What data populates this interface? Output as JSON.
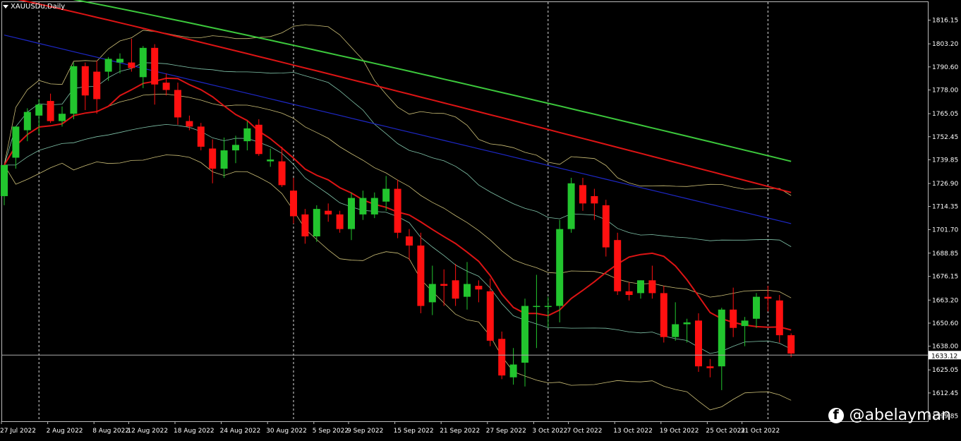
{
  "symbol": "XAUUSDu,Daily",
  "watermark": {
    "icon": "facebook-icon",
    "handle": "@abelayman"
  },
  "current_price": "1633.12",
  "colors": {
    "background": "#000000",
    "bull": "#22c52e",
    "bear": "#ff1010",
    "ma_green": "#3cc83c",
    "ma_red": "#dc1414",
    "ma_blue": "#1e28c8",
    "bb_outer": "#f0e08c",
    "bb_inner": "#96e6c8",
    "price_line": "#aaaaaa"
  },
  "chart_data": {
    "type": "candlestick",
    "ylim": [
      1597,
      1826
    ],
    "y_ticks": [
      "1816.15",
      "1803.20",
      "1790.60",
      "1778.00",
      "1765.05",
      "1752.45",
      "1739.85",
      "1726.90",
      "1714.35",
      "1701.70",
      "1688.85",
      "1676.15",
      "1663.20",
      "1650.60",
      "1638.00",
      "1625.05",
      "1612.45",
      "1599.85"
    ],
    "x_labels": [
      "27 Jul 2022",
      "2 Aug 2022",
      "8 Aug 2022",
      "12 Aug 2022",
      "18 Aug 2022",
      "24 Aug 2022",
      "30 Aug 2022",
      "5 Sep 2022",
      "9 Sep 2022",
      "15 Sep 2022",
      "21 Sep 2022",
      "27 Sep 2022",
      "3 Oct 2022",
      "7 Oct 2022",
      "13 Oct 2022",
      "19 Oct 2022",
      "25 Oct 2022",
      "31 Oct 2022"
    ],
    "candles": [
      {
        "o": 1720,
        "h": 1736,
        "l": 1715,
        "c": 1737
      },
      {
        "o": 1741,
        "h": 1758,
        "l": 1735,
        "c": 1758
      },
      {
        "o": 1756,
        "h": 1768,
        "l": 1750,
        "c": 1766
      },
      {
        "o": 1764,
        "h": 1773,
        "l": 1754,
        "c": 1770
      },
      {
        "o": 1772,
        "h": 1776,
        "l": 1760,
        "c": 1761
      },
      {
        "o": 1761,
        "h": 1769,
        "l": 1758,
        "c": 1765
      },
      {
        "o": 1765,
        "h": 1793,
        "l": 1762,
        "c": 1791
      },
      {
        "o": 1791,
        "h": 1793,
        "l": 1767,
        "c": 1775
      },
      {
        "o": 1788,
        "h": 1794,
        "l": 1765,
        "c": 1773
      },
      {
        "o": 1788,
        "h": 1796,
        "l": 1783,
        "c": 1795
      },
      {
        "o": 1793,
        "h": 1798,
        "l": 1787,
        "c": 1795
      },
      {
        "o": 1793,
        "h": 1806,
        "l": 1788,
        "c": 1790
      },
      {
        "o": 1785,
        "h": 1802,
        "l": 1779,
        "c": 1801
      },
      {
        "o": 1801,
        "h": 1803,
        "l": 1770,
        "c": 1781
      },
      {
        "o": 1782,
        "h": 1787,
        "l": 1775,
        "c": 1778
      },
      {
        "o": 1778,
        "h": 1782,
        "l": 1759,
        "c": 1763
      },
      {
        "o": 1761,
        "h": 1764,
        "l": 1756,
        "c": 1758
      },
      {
        "o": 1758,
        "h": 1760,
        "l": 1745,
        "c": 1747
      },
      {
        "o": 1746,
        "h": 1751,
        "l": 1727,
        "c": 1735
      },
      {
        "o": 1735,
        "h": 1752,
        "l": 1730,
        "c": 1745
      },
      {
        "o": 1745,
        "h": 1753,
        "l": 1738,
        "c": 1748
      },
      {
        "o": 1750,
        "h": 1761,
        "l": 1745,
        "c": 1757
      },
      {
        "o": 1759,
        "h": 1762,
        "l": 1742,
        "c": 1743
      },
      {
        "o": 1739,
        "h": 1746,
        "l": 1736,
        "c": 1740
      },
      {
        "o": 1739,
        "h": 1747,
        "l": 1725,
        "c": 1726
      },
      {
        "o": 1723,
        "h": 1730,
        "l": 1705,
        "c": 1709
      },
      {
        "o": 1710,
        "h": 1713,
        "l": 1694,
        "c": 1698
      },
      {
        "o": 1698,
        "h": 1715,
        "l": 1695,
        "c": 1713
      },
      {
        "o": 1712,
        "h": 1716,
        "l": 1706,
        "c": 1710
      },
      {
        "o": 1710,
        "h": 1712,
        "l": 1700,
        "c": 1702
      },
      {
        "o": 1702,
        "h": 1722,
        "l": 1696,
        "c": 1719
      },
      {
        "o": 1710,
        "h": 1723,
        "l": 1707,
        "c": 1719
      },
      {
        "o": 1710,
        "h": 1722,
        "l": 1708,
        "c": 1719
      },
      {
        "o": 1717,
        "h": 1731,
        "l": 1712,
        "c": 1724
      },
      {
        "o": 1724,
        "h": 1729,
        "l": 1697,
        "c": 1700
      },
      {
        "o": 1698,
        "h": 1702,
        "l": 1685,
        "c": 1693
      },
      {
        "o": 1693,
        "h": 1700,
        "l": 1656,
        "c": 1660
      },
      {
        "o": 1662,
        "h": 1682,
        "l": 1655,
        "c": 1672
      },
      {
        "o": 1672,
        "h": 1680,
        "l": 1660,
        "c": 1671
      },
      {
        "o": 1674,
        "h": 1683,
        "l": 1660,
        "c": 1664
      },
      {
        "o": 1665,
        "h": 1684,
        "l": 1658,
        "c": 1672
      },
      {
        "o": 1671,
        "h": 1674,
        "l": 1662,
        "c": 1669
      },
      {
        "o": 1668,
        "h": 1675,
        "l": 1638,
        "c": 1641
      },
      {
        "o": 1642,
        "h": 1646,
        "l": 1620,
        "c": 1622
      },
      {
        "o": 1621,
        "h": 1637,
        "l": 1617,
        "c": 1628
      },
      {
        "o": 1629,
        "h": 1664,
        "l": 1616,
        "c": 1660
      },
      {
        "o": 1660,
        "h": 1677,
        "l": 1637,
        "c": 1660
      },
      {
        "o": 1660,
        "h": 1665,
        "l": 1648,
        "c": 1660
      },
      {
        "o": 1660,
        "h": 1707,
        "l": 1651,
        "c": 1702
      },
      {
        "o": 1702,
        "h": 1730,
        "l": 1700,
        "c": 1727
      },
      {
        "o": 1726,
        "h": 1730,
        "l": 1712,
        "c": 1716
      },
      {
        "o": 1720,
        "h": 1724,
        "l": 1707,
        "c": 1716
      },
      {
        "o": 1715,
        "h": 1718,
        "l": 1687,
        "c": 1692
      },
      {
        "o": 1696,
        "h": 1700,
        "l": 1666,
        "c": 1668
      },
      {
        "o": 1668,
        "h": 1673,
        "l": 1663,
        "c": 1666
      },
      {
        "o": 1667,
        "h": 1674,
        "l": 1664,
        "c": 1674
      },
      {
        "o": 1674,
        "h": 1682,
        "l": 1664,
        "c": 1667
      },
      {
        "o": 1667,
        "h": 1671,
        "l": 1640,
        "c": 1643
      },
      {
        "o": 1643,
        "h": 1662,
        "l": 1641,
        "c": 1650
      },
      {
        "o": 1650,
        "h": 1653,
        "l": 1640,
        "c": 1651
      },
      {
        "o": 1652,
        "h": 1656,
        "l": 1624,
        "c": 1627
      },
      {
        "o": 1627,
        "h": 1631,
        "l": 1621,
        "c": 1626
      },
      {
        "o": 1627,
        "h": 1659,
        "l": 1614,
        "c": 1658
      },
      {
        "o": 1658,
        "h": 1670,
        "l": 1643,
        "c": 1648
      },
      {
        "o": 1649,
        "h": 1654,
        "l": 1638,
        "c": 1652
      },
      {
        "o": 1653,
        "h": 1667,
        "l": 1648,
        "c": 1665
      },
      {
        "o": 1665,
        "h": 1671,
        "l": 1657,
        "c": 1664
      },
      {
        "o": 1663,
        "h": 1666,
        "l": 1640,
        "c": 1644
      },
      {
        "o": 1644,
        "h": 1645,
        "l": 1632,
        "c": 1634
      }
    ],
    "ma_lengths": {
      "red_fast": 10,
      "red_slow": 100,
      "blue": 80,
      "green": 150
    },
    "bands": {
      "inner_len": 20,
      "inner_k": 1,
      "outer_len": 20,
      "outer_k": 2
    },
    "grid": false,
    "legend": "none"
  }
}
